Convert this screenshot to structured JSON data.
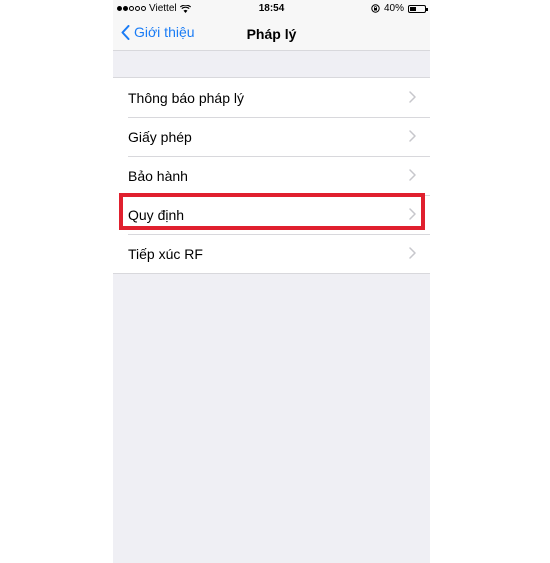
{
  "status_bar": {
    "carrier": "Viettel",
    "time": "18:54",
    "battery": "40%",
    "battery_level": 0.4,
    "icons": [
      "signal-dots-icon",
      "wifi-icon",
      "rotation-lock-icon",
      "battery-icon"
    ]
  },
  "nav": {
    "back_label": "Giới thiệu",
    "title": "Pháp lý"
  },
  "list": {
    "items": [
      {
        "label": "Thông báo pháp lý"
      },
      {
        "label": "Giấy phép"
      },
      {
        "label": "Bảo hành"
      },
      {
        "label": "Quy định"
      },
      {
        "label": "Tiếp xúc RF"
      }
    ]
  },
  "colors": {
    "accent": "#1a7cf5",
    "highlight": "#e0202e",
    "background": "#efeff4"
  }
}
